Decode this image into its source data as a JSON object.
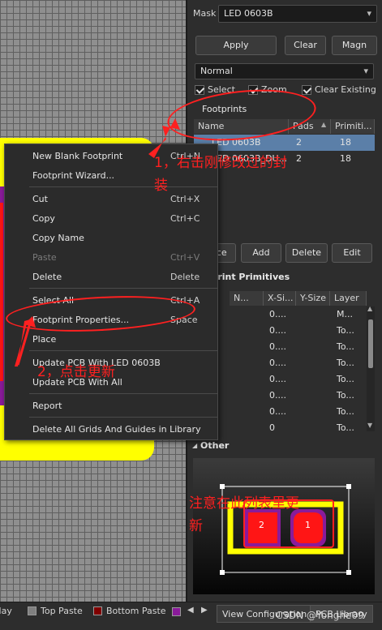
{
  "panel": {
    "mask_label": "Mask",
    "mask_value": "LED 0603B",
    "apply_button": "Apply",
    "clear_button": "Clear",
    "magnify_button": "Magn",
    "mode_select": "Normal",
    "select_check": "Select",
    "zoom_check": "Zoom",
    "clear_existing_check": "Clear Existing",
    "footprints_header": "Footprints",
    "footprints_columns": [
      "Name",
      "Pads",
      "Primiti..."
    ],
    "footprints_rows": [
      {
        "name": "LED 0603B",
        "pads": "2",
        "primitives": "18"
      },
      {
        "name": "LED 0603B_DU...",
        "pads": "2",
        "primitives": "18"
      }
    ],
    "place_button": "Place",
    "add_button": "Add",
    "delete_button": "Delete",
    "edit_button": "Edit",
    "primitives_header": "Footprint Primitives",
    "primitives_columns": [
      "N...",
      "X-Si...",
      "Y-Size",
      "Layer"
    ],
    "primitives_rows": [
      {
        "x": "0....",
        "layer": "M..."
      },
      {
        "x": "0....",
        "layer": "To..."
      },
      {
        "x": "0....",
        "layer": "To..."
      },
      {
        "x": "0....",
        "layer": "To..."
      },
      {
        "x": "0....",
        "layer": "To..."
      },
      {
        "x": "0....",
        "layer": "To..."
      },
      {
        "x": "0....",
        "layer": "To..."
      },
      {
        "x": "0",
        "layer": "To..."
      }
    ],
    "other_header": "Other",
    "pad1_label": "1",
    "pad2_label": "2"
  },
  "context_menu": {
    "items": [
      {
        "label": "New Blank Footprint",
        "shortcut": "Ctrl+N",
        "disabled": false
      },
      {
        "label": "Footprint Wizard...",
        "shortcut": "",
        "disabled": false
      },
      {
        "label": "Cut",
        "shortcut": "Ctrl+X",
        "disabled": false
      },
      {
        "label": "Copy",
        "shortcut": "Ctrl+C",
        "disabled": false
      },
      {
        "label": "Copy Name",
        "shortcut": "",
        "disabled": false
      },
      {
        "label": "Paste",
        "shortcut": "Ctrl+V",
        "disabled": true
      },
      {
        "label": "Delete",
        "shortcut": "Delete",
        "disabled": false
      },
      {
        "label": "Select All",
        "shortcut": "Ctrl+A",
        "disabled": false
      },
      {
        "label": "Footprint Properties...",
        "shortcut": "Space",
        "disabled": false
      },
      {
        "label": "Place",
        "shortcut": "",
        "disabled": false
      },
      {
        "label": "Update PCB With LED 0603B",
        "shortcut": "",
        "disabled": false
      },
      {
        "label": "Update PCB With All",
        "shortcut": "",
        "disabled": false
      },
      {
        "label": "Report",
        "shortcut": "",
        "disabled": false
      },
      {
        "label": "Delete All Grids And Guides in Library",
        "shortcut": "",
        "disabled": false
      }
    ]
  },
  "annotations": {
    "step1_line1": "1，右击刚修改过的封",
    "step1_line2": "装",
    "step2": "2，点击更新",
    "note_line1": "注意在此列表里更",
    "note_line2": "新"
  },
  "bottom_bar": {
    "layers": [
      {
        "label": "rlay",
        "color": "#ffffff"
      },
      {
        "label": "Top Paste",
        "color": "#808080"
      },
      {
        "label": "Bottom Paste",
        "color": "#800000"
      }
    ],
    "tab_view_config": "View Configuration",
    "tab_pcb_library": "PCB Library",
    "watermark": "CSDN @Yonghe09"
  },
  "colors": {
    "accent_red": "#ff2020",
    "silkscreen_yellow": "#ffff00",
    "pad_red": "#ff1515",
    "selection_blue": "#5b7fa8"
  }
}
